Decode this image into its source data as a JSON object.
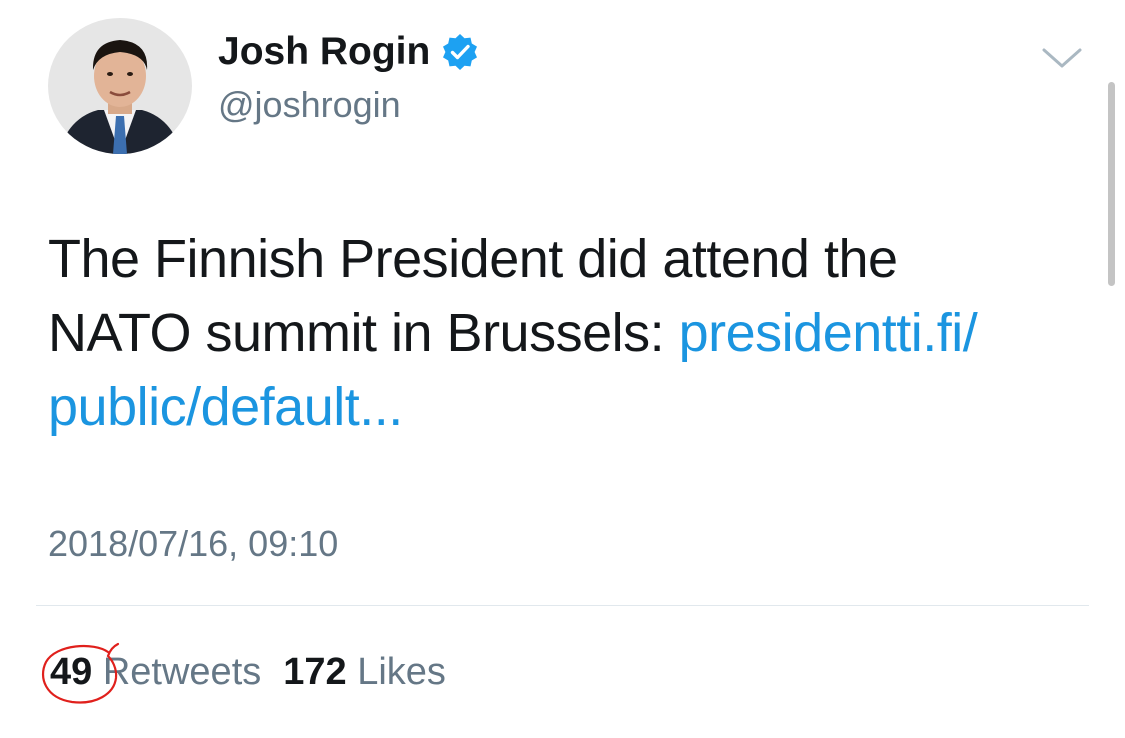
{
  "profile": {
    "display_name": "Josh Rogin",
    "handle": "@joshrogin",
    "verified": true
  },
  "tweet": {
    "text_line1": "The Finnish President did attend the",
    "text_line2_prefix": "NATO summit in Brussels: ",
    "link_part1": "presidentti.fi/",
    "link_part2": "public/default...",
    "timestamp": "2018/07/16, 09:10"
  },
  "stats": {
    "retweets_count": "49",
    "retweets_label": "Retweets",
    "likes_count": "172",
    "likes_label": "Likes"
  },
  "icons": {
    "verified": "verified-badge-icon",
    "menu": "chevron-down-icon"
  },
  "colors": {
    "link": "#1b95e0",
    "text": "#14171a",
    "secondary": "#657786",
    "verified": "#1da1f2",
    "annotation": "#e0201c"
  }
}
